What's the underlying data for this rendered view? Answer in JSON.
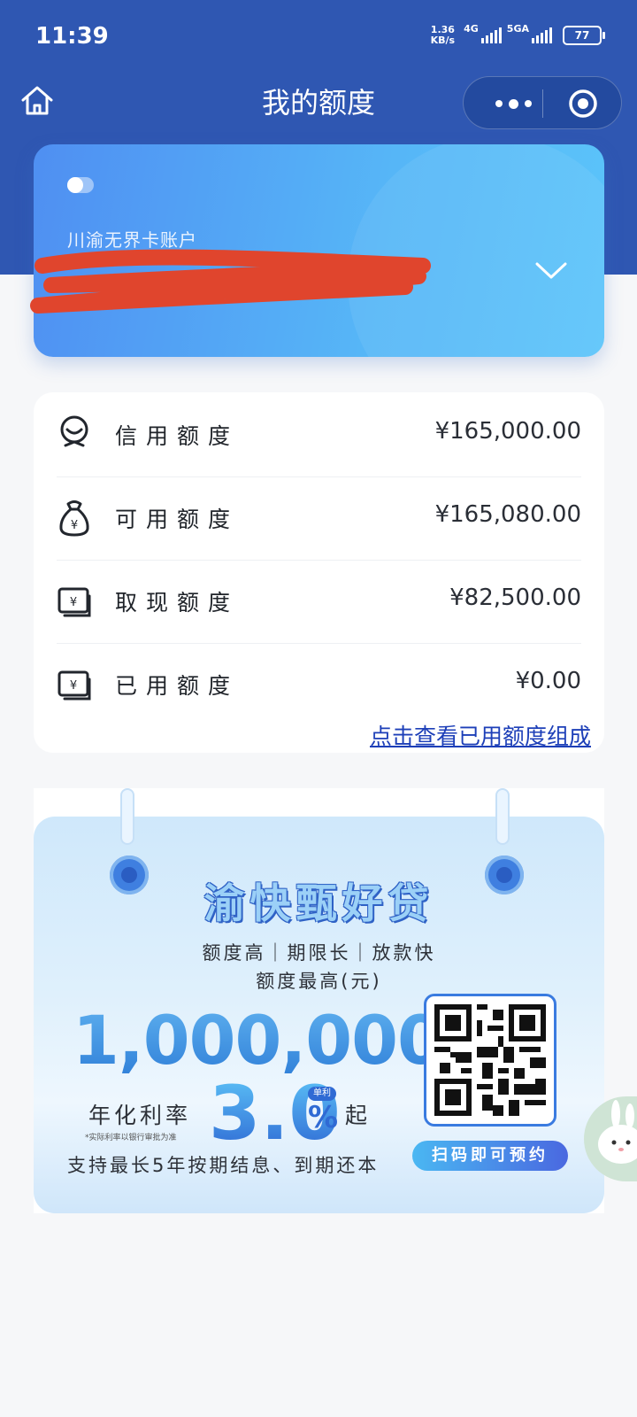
{
  "status_bar": {
    "time": "11:39",
    "net_speed_value": "1.36",
    "net_speed_unit": "KB/s",
    "net1": "4G",
    "net2": "5GA",
    "battery": "77"
  },
  "nav": {
    "title": "我的额度"
  },
  "account": {
    "name": "川渝无界卡账户"
  },
  "credit": {
    "items": [
      {
        "label": "信用额度",
        "value": "¥165,000.00"
      },
      {
        "label": "可用额度",
        "value": "¥165,080.00"
      },
      {
        "label": "取现额度",
        "value": "¥82,500.00"
      },
      {
        "label": "已用额度",
        "value": "¥0.00"
      }
    ],
    "detail_link": "点击查看已用额度组成"
  },
  "promo": {
    "title": "渝快甄好贷",
    "features": "额度高｜期限长｜放款快",
    "max_label": "额度最高(元)",
    "max_amount": "1,000,000",
    "rate_label": "年化利率",
    "rate_note": "*实际利率以银行审批为准",
    "rate_value": "3.0",
    "rate_tag": "单利",
    "rate_unit": "%",
    "rate_suffix": "起",
    "support_text": "支持最长5年按期结息、到期还本",
    "scan_button": "扫码即可预约"
  },
  "colors": {
    "header": "#2f57b2",
    "card_start": "#4f8ff2",
    "card_end": "#5bc4fa",
    "link": "#1d3fb8",
    "accent": "#2f6ad4"
  }
}
